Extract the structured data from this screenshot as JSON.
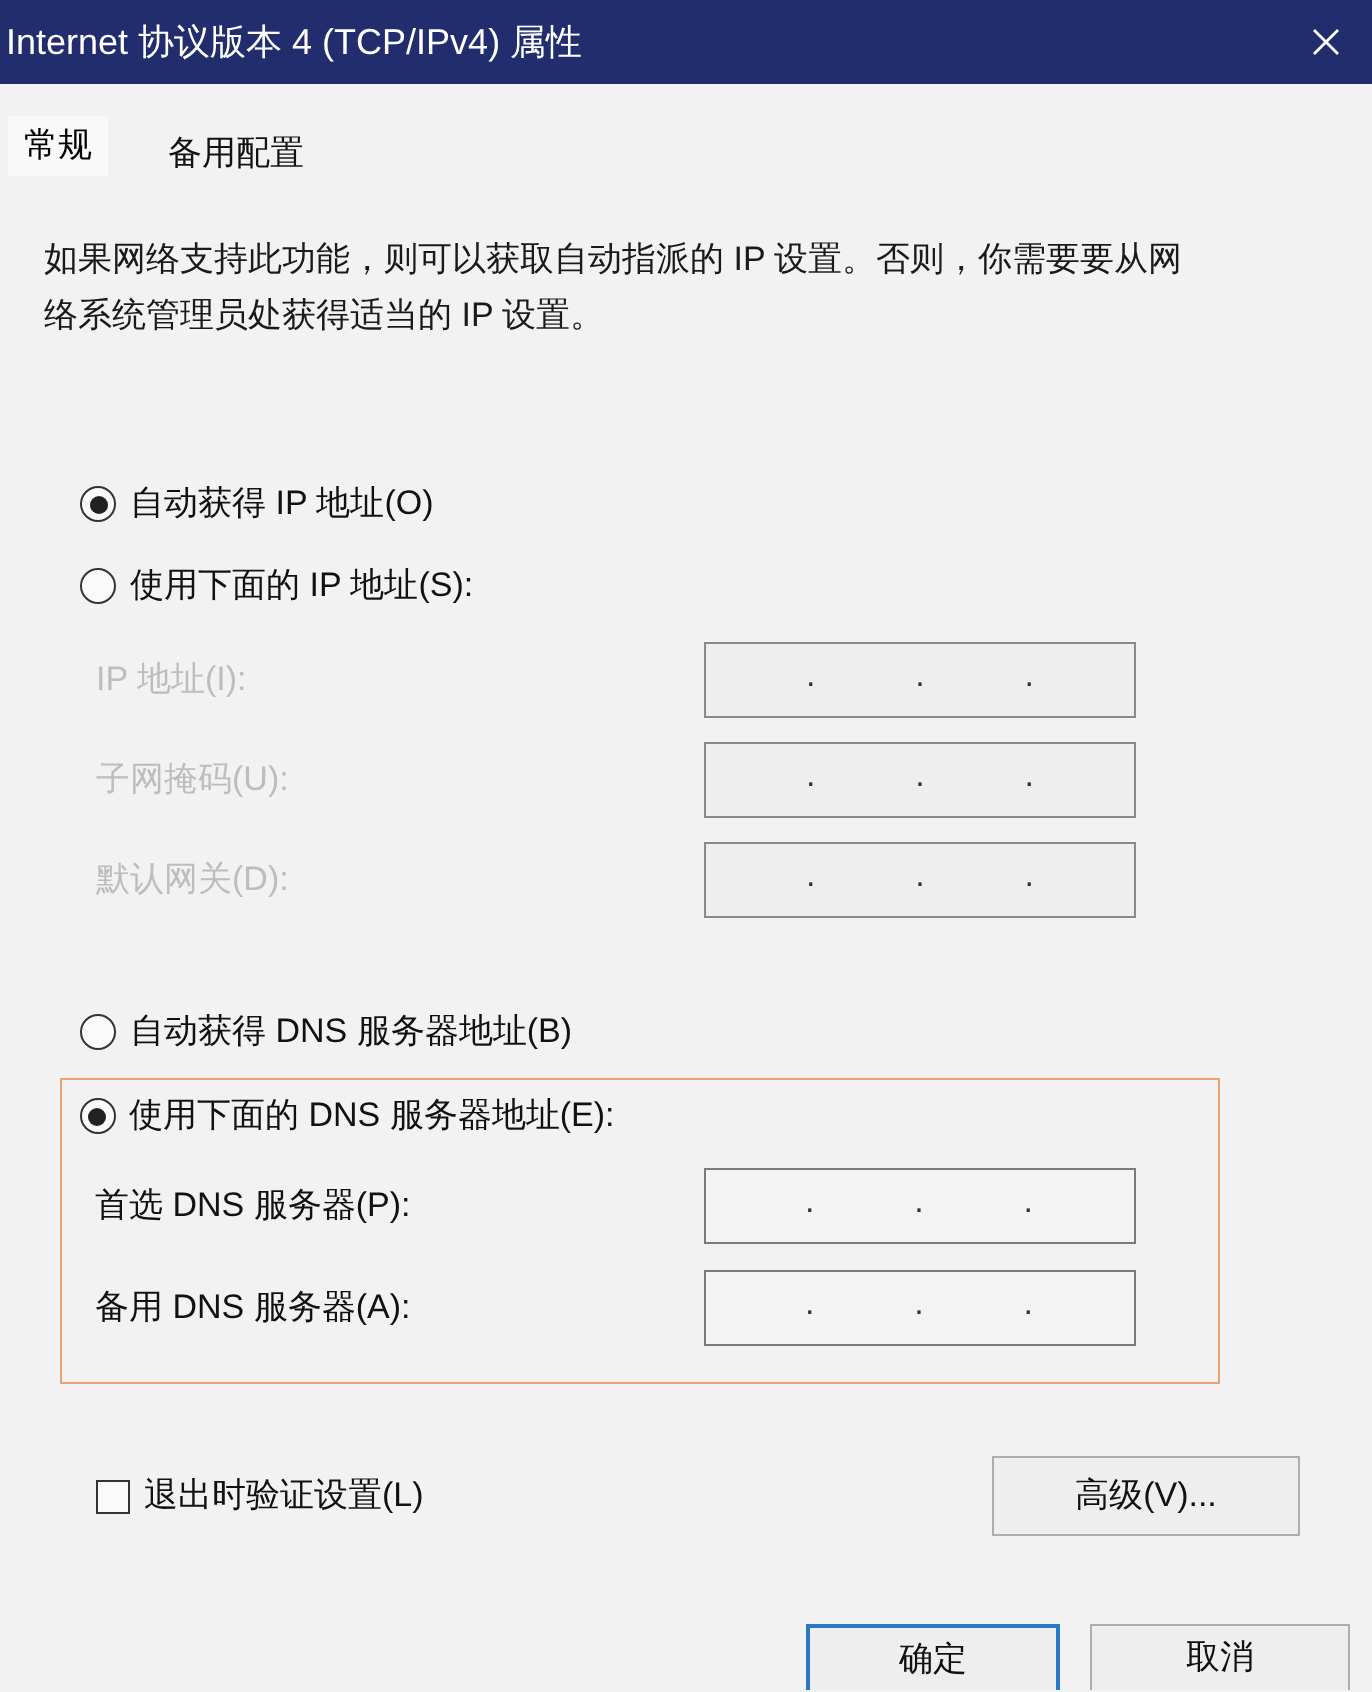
{
  "window": {
    "title": "Internet 协议版本 4 (TCP/IPv4) 属性"
  },
  "tabs": [
    {
      "label": "常规",
      "selected": true
    },
    {
      "label": "备用配置",
      "selected": false
    }
  ],
  "description": "如果网络支持此功能，则可以获取自动指派的 IP 设置。否则，你需要要从网络系统管理员处获得适当的 IP 设置。",
  "ip": {
    "options": [
      {
        "label": "自动获得 IP 地址(O)",
        "selected": true
      },
      {
        "label": "使用下面的 IP 地址(S):",
        "selected": false
      }
    ],
    "fields": [
      {
        "label": "IP 地址(I):",
        "disabled": true,
        "dots": [
          ".",
          ".",
          "."
        ]
      },
      {
        "label": "子网掩码(U):",
        "disabled": true,
        "dots": [
          ".",
          ".",
          "."
        ]
      },
      {
        "label": "默认网关(D):",
        "disabled": true,
        "dots": [
          ".",
          ".",
          "."
        ]
      }
    ]
  },
  "dns": {
    "options": [
      {
        "label": "自动获得 DNS 服务器地址(B)",
        "selected": false
      },
      {
        "label": "使用下面的 DNS 服务器地址(E):",
        "selected": true
      }
    ],
    "highlighted": true,
    "fields": [
      {
        "label": "首选 DNS 服务器(P):",
        "disabled": false,
        "dots": [
          ".",
          ".",
          "."
        ]
      },
      {
        "label": "备用 DNS 服务器(A):",
        "disabled": false,
        "dots": [
          ".",
          ".",
          "."
        ]
      }
    ]
  },
  "validate_checkbox": {
    "label": "退出时验证设置(L)",
    "checked": false
  },
  "advanced_button": {
    "label": "高级(V)..."
  },
  "dialog_buttons": [
    {
      "label": "确定",
      "default": true
    },
    {
      "label": "取消",
      "default": false
    }
  ]
}
